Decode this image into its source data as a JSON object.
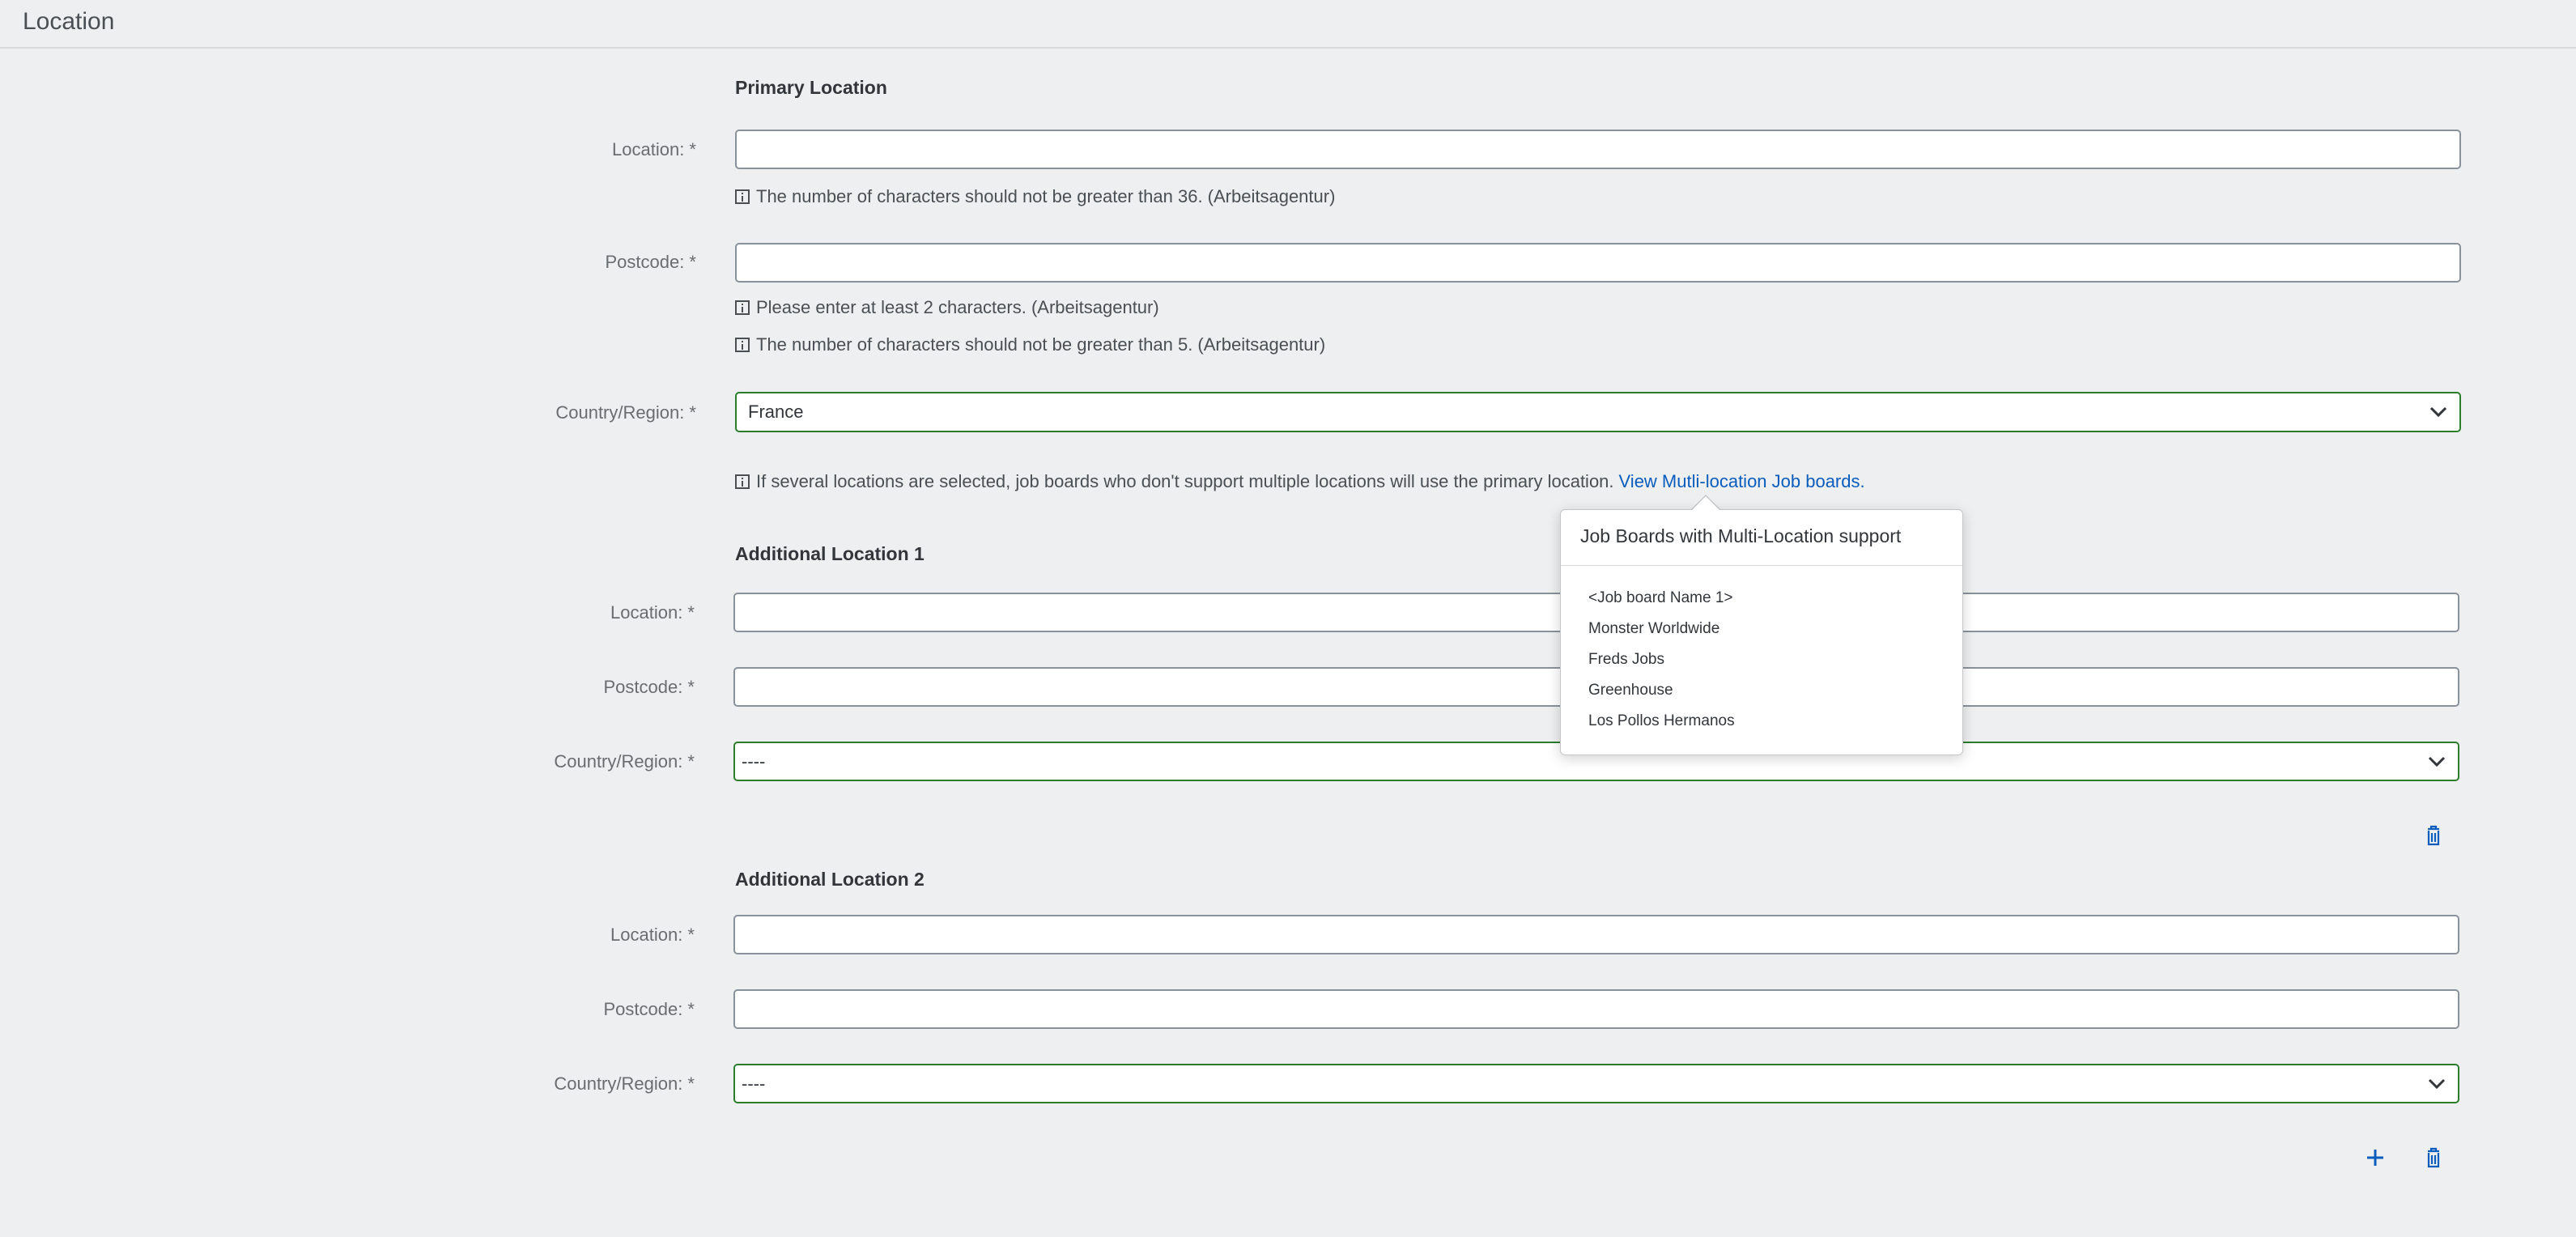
{
  "header": {
    "title": "Location"
  },
  "primary": {
    "title": "Primary Location",
    "location_label": "Location: *",
    "location_value": "",
    "location_msg": "The number of characters should not be greater than 36. (Arbeitsagentur)",
    "postcode_label": "Postcode: *",
    "postcode_value": "",
    "postcode_msg1": "Please enter at least 2 characters. (Arbeitsagentur)",
    "postcode_msg2": "The number of characters should not be greater than 5. (Arbeitsagentur)",
    "country_label": "Country/Region: *",
    "country_value": "France",
    "multi_msg": "If several locations are selected, job boards who don't support multiple locations will use the primary location.",
    "multi_link": "View Mutli-location Job boards."
  },
  "additional1": {
    "title": "Additional Location 1",
    "location_label": "Location: *",
    "location_value": "",
    "postcode_label": "Postcode: *",
    "postcode_value": "",
    "country_label": "Country/Region: *",
    "country_value": "----"
  },
  "additional2": {
    "title": "Additional Location 2",
    "location_label": "Location: *",
    "location_value": "",
    "postcode_label": "Postcode: *",
    "postcode_value": "",
    "country_label": "Country/Region: *",
    "country_value": "----"
  },
  "popover": {
    "title": "Job Boards with Multi-Location support",
    "items": [
      "<Job board Name 1>",
      "Monster Worldwide",
      "Freds Jobs",
      "Greenhouse",
      "Los Pollos Hermanos"
    ]
  },
  "icons": {
    "delete": "trash-icon",
    "add": "plus-icon",
    "info": "info-icon",
    "dropdown": "chevron-down-icon"
  },
  "colors": {
    "accent": "#0a5dbd",
    "valid_border": "#2b7c2b",
    "background": "#edeff0"
  }
}
